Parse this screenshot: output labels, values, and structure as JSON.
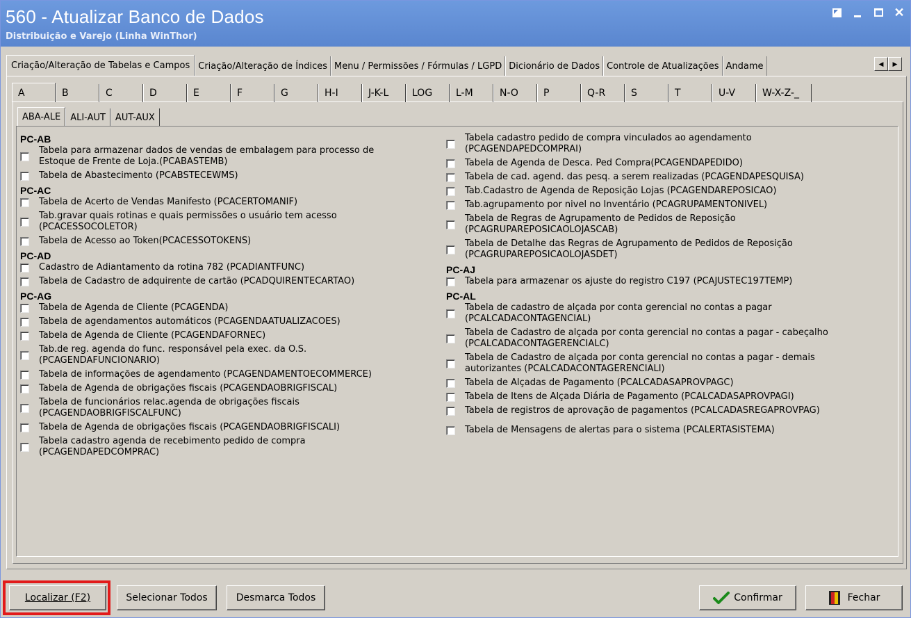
{
  "window": {
    "title": "560 - Atualizar Banco de Dados",
    "subtitle": "Distribuição e Varejo (Linha WinThor)"
  },
  "top_tabs": [
    {
      "label": "Criação/Alteração de Tabelas e Campos",
      "active": true
    },
    {
      "label": "Criação/Alteração de Índices"
    },
    {
      "label": "Menu / Permissões / Fórmulas / LGPD"
    },
    {
      "label": "Dicionário de Dados"
    },
    {
      "label": "Controle de Atualizações"
    },
    {
      "label": "Andame"
    }
  ],
  "letter_tabs": [
    "A",
    "B",
    "C",
    "D",
    "E",
    "F",
    "G",
    "H-I",
    "J-K-L",
    "LOG",
    "L-M",
    "N-O",
    "P",
    "Q-R",
    "S",
    "T",
    "U-V",
    "W-X-Z-_"
  ],
  "sub_tabs": [
    "ABA-ALE",
    "ALI-AUT",
    "AUT-AUX"
  ],
  "left_column": [
    {
      "type": "head",
      "text": "PC-AB"
    },
    {
      "type": "item",
      "lines": [
        "Tabela para armazenar dados de vendas de embalagem para processo de",
        "Estoque de Frente de Loja.(PCABASTEMB)"
      ]
    },
    {
      "type": "item",
      "lines": [
        "Tabela de Abastecimento (PCABSTECEWMS)"
      ]
    },
    {
      "type": "head",
      "text": "PC-AC"
    },
    {
      "type": "item",
      "lines": [
        "Tabela de Acerto de Vendas Manifesto (PCACERTOMANIF)"
      ]
    },
    {
      "type": "item",
      "lines": [
        "Tab.gravar quais rotinas e quais permissões o usuário tem acesso",
        "(PCACESSOCOLETOR)"
      ]
    },
    {
      "type": "item",
      "lines": [
        "Tabela de Acesso ao Token(PCACESSOTOKENS)"
      ]
    },
    {
      "type": "head",
      "text": "PC-AD"
    },
    {
      "type": "item",
      "lines": [
        "Cadastro de Adiantamento da rotina 782 (PCADIANTFUNC)"
      ]
    },
    {
      "type": "item",
      "lines": [
        "Tabela de Cadastro de adquirente de cartão (PCADQUIRENTECARTAO)"
      ]
    },
    {
      "type": "head",
      "text": "PC-AG"
    },
    {
      "type": "item",
      "lines": [
        "Tabela  de Agenda de Cliente (PCAGENDA)"
      ]
    },
    {
      "type": "item",
      "lines": [
        "Tabela de agendamentos automáticos (PCAGENDAATUALIZACOES)"
      ]
    },
    {
      "type": "item",
      "lines": [
        "Tabela  de Agenda de Cliente (PCAGENDAFORNEC)"
      ]
    },
    {
      "type": "item",
      "lines": [
        "Tab.de reg. agenda do func. responsável pela exec. da O.S.",
        "(PCAGENDAFUNCIONARIO)"
      ]
    },
    {
      "type": "item",
      "lines": [
        "Tabela de informações de agendamento (PCAGENDAMENTOECOMMERCE)"
      ]
    },
    {
      "type": "item",
      "lines": [
        "Tabela de Agenda de obrigações fiscais (PCAGENDAOBRIGFISCAL)"
      ]
    },
    {
      "type": "item",
      "lines": [
        "Tabela de funcionários relac.agenda de obrigações fiscais",
        "(PCAGENDAOBRIGFISCALFUNC)"
      ]
    },
    {
      "type": "item",
      "lines": [
        "Tabela de Agenda de obrigações fiscais (PCAGENDAOBRIGFISCALI)"
      ]
    },
    {
      "type": "item",
      "lines": [
        "Tabela cadastro agenda de recebimento pedido de compra",
        "(PCAGENDAPEDCOMPRAC)"
      ]
    }
  ],
  "right_column": [
    {
      "type": "item",
      "lines": [
        "Tabela cadastro pedido de compra vinculados ao agendamento",
        "(PCAGENDAPEDCOMPRAI)"
      ]
    },
    {
      "type": "item",
      "lines": [
        "Tabela  de Agenda de Desca. Ped Compra(PCAGENDAPEDIDO)"
      ]
    },
    {
      "type": "item",
      "lines": [
        "Tabela de cad. agend. das pesq. a serem realizadas (PCAGENDAPESQUISA)"
      ]
    },
    {
      "type": "item",
      "lines": [
        "Tab.Cadastro de Agenda de Reposição Lojas (PCAGENDAREPOSICAO)"
      ]
    },
    {
      "type": "item",
      "lines": [
        "Tab.agrupamento por nivel no Inventário (PCAGRUPAMENTONIVEL)"
      ]
    },
    {
      "type": "item",
      "lines": [
        "Tabela de Regras de Agrupamento de Pedidos de Reposição",
        "(PCAGRUPAREPOSICAOLOJASCAB)"
      ]
    },
    {
      "type": "item",
      "lines": [
        "Tabela de Detalhe das Regras de Agrupamento de Pedidos de Reposição",
        "(PCAGRUPAREPOSICAOLOJASDET)"
      ]
    },
    {
      "type": "head",
      "text": "PC-AJ"
    },
    {
      "type": "item",
      "lines": [
        "Tabela para armazenar os ajuste do registro C197 (PCAJUSTEC197TEMP)"
      ]
    },
    {
      "type": "head",
      "text": "PC-AL"
    },
    {
      "type": "item",
      "lines": [
        "Tabela de cadastro de alçada por conta gerencial no contas a pagar",
        "(PCALCADACONTAGENCIAL)"
      ]
    },
    {
      "type": "item",
      "lines": [
        "Tabela de Cadastro de alçada por conta gerencial no contas a pagar - cabeçalho",
        "(PCALCADACONTAGERENCIALC)"
      ]
    },
    {
      "type": "item",
      "lines": [
        "Tabela de Cadastro de alçada por conta gerencial no contas a pagar - demais",
        "autorizantes  (PCALCADACONTAGERENCIALI)"
      ]
    },
    {
      "type": "item",
      "lines": [
        "Tabela de Alçadas de Pagamento (PCALCADASAPROVPAGC)"
      ]
    },
    {
      "type": "item",
      "lines": [
        "Tabela de Itens de Alçada Diária de Pagamento (PCALCADASAPROVPAGI)"
      ]
    },
    {
      "type": "item",
      "lines": [
        "Tabela de registros de aprovação de pagamentos (PCALCADASREGAPROVPAG)"
      ],
      "gap": true
    },
    {
      "type": "item",
      "lines": [
        "Tabela de Mensagens de alertas para o sistema (PCALERTASISTEMA)"
      ],
      "gap": true
    }
  ],
  "buttons": {
    "localizar": "Localizar (F2)",
    "selecionar": "Selecionar Todos",
    "desmarca": "Desmarca Todos",
    "confirmar": "Confirmar",
    "fechar": "Fechar"
  },
  "colors": {
    "titlebar": "#5a86cf",
    "highlight": "#e21a1a",
    "confirm_check": "#1a8a1a"
  }
}
